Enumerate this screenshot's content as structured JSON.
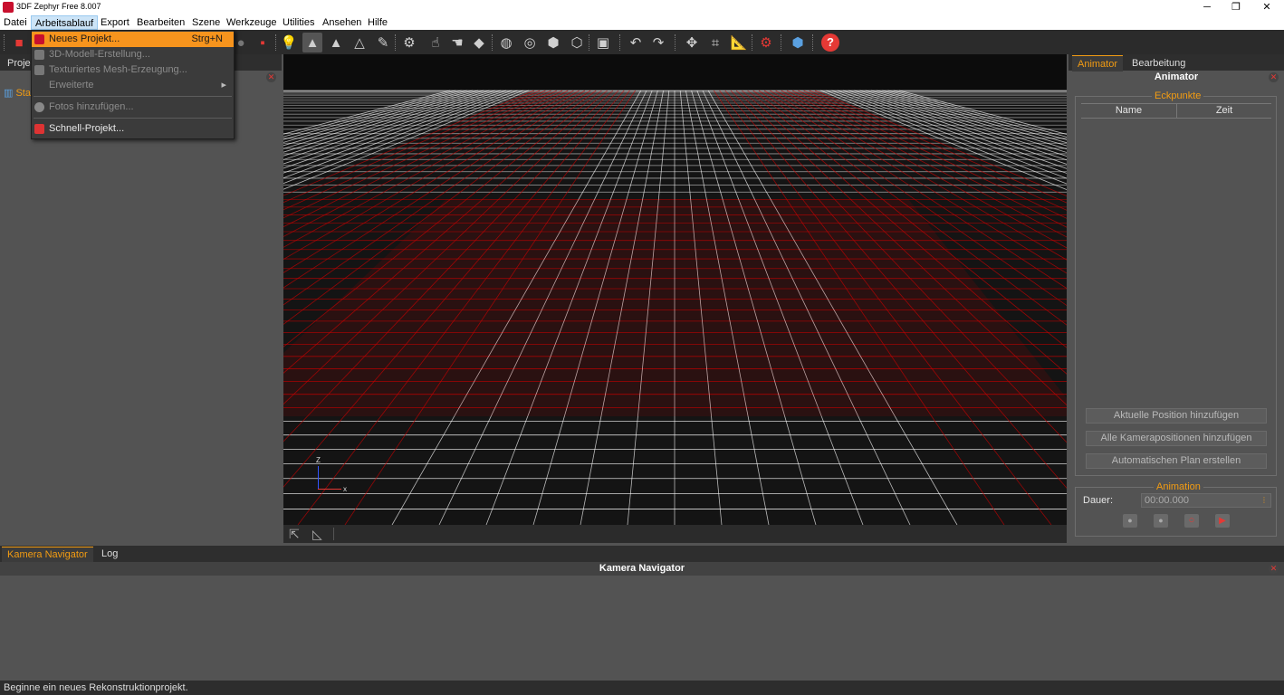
{
  "window": {
    "title": "3DF Zephyr Free 8.007",
    "minimize_icon": "─",
    "restore_icon": "❐",
    "close_icon": "✕"
  },
  "menubar": [
    "Datei",
    "Arbeitsablauf",
    "Export",
    "Bearbeiten",
    "Szene",
    "Werkzeuge",
    "Utilities",
    "Ansehen",
    "Hilfe"
  ],
  "dropdown": {
    "new_project": "Neues Projekt...",
    "new_project_shortcut": "Strg+N",
    "model_creation": "3D-Modell-Erstellung...",
    "textured_mesh": "Texturiertes Mesh-Erzeugung...",
    "advanced": "Erweiterte",
    "add_photos": "Fotos hinzufügen...",
    "quick_project": "Schnell-Projekt..."
  },
  "left_panel": {
    "tab_label": "Projekt",
    "tree_item": "Sta"
  },
  "viewport": {
    "axis_z": "Z",
    "axis_x": "x",
    "grid_color": "#ffffff",
    "floor_color": "#cc0000"
  },
  "right_panel": {
    "tabs": [
      "Animator",
      "Bearbeitung"
    ],
    "header": "Animator",
    "keyframes_group": "Eckpunkte",
    "col_name": "Name",
    "col_time": "Zeit",
    "btn_add_current": "Aktuelle Position hinzufügen",
    "btn_add_all": "Alle Kamerapositionen hinzufügen",
    "btn_auto_plan": "Automatischen Plan erstellen",
    "animation_group": "Animation",
    "duration_label": "Dauer:",
    "duration_value": "00:00.000"
  },
  "bottom_panel": {
    "tabs": [
      "Kamera Navigator",
      "Log"
    ],
    "header": "Kamera Navigator"
  },
  "status": "Beginne ein neues Rekonstruktionprojekt.",
  "colors": {
    "accent": "#f39c12",
    "highlight": "#f7941d",
    "close": "#e53935"
  }
}
